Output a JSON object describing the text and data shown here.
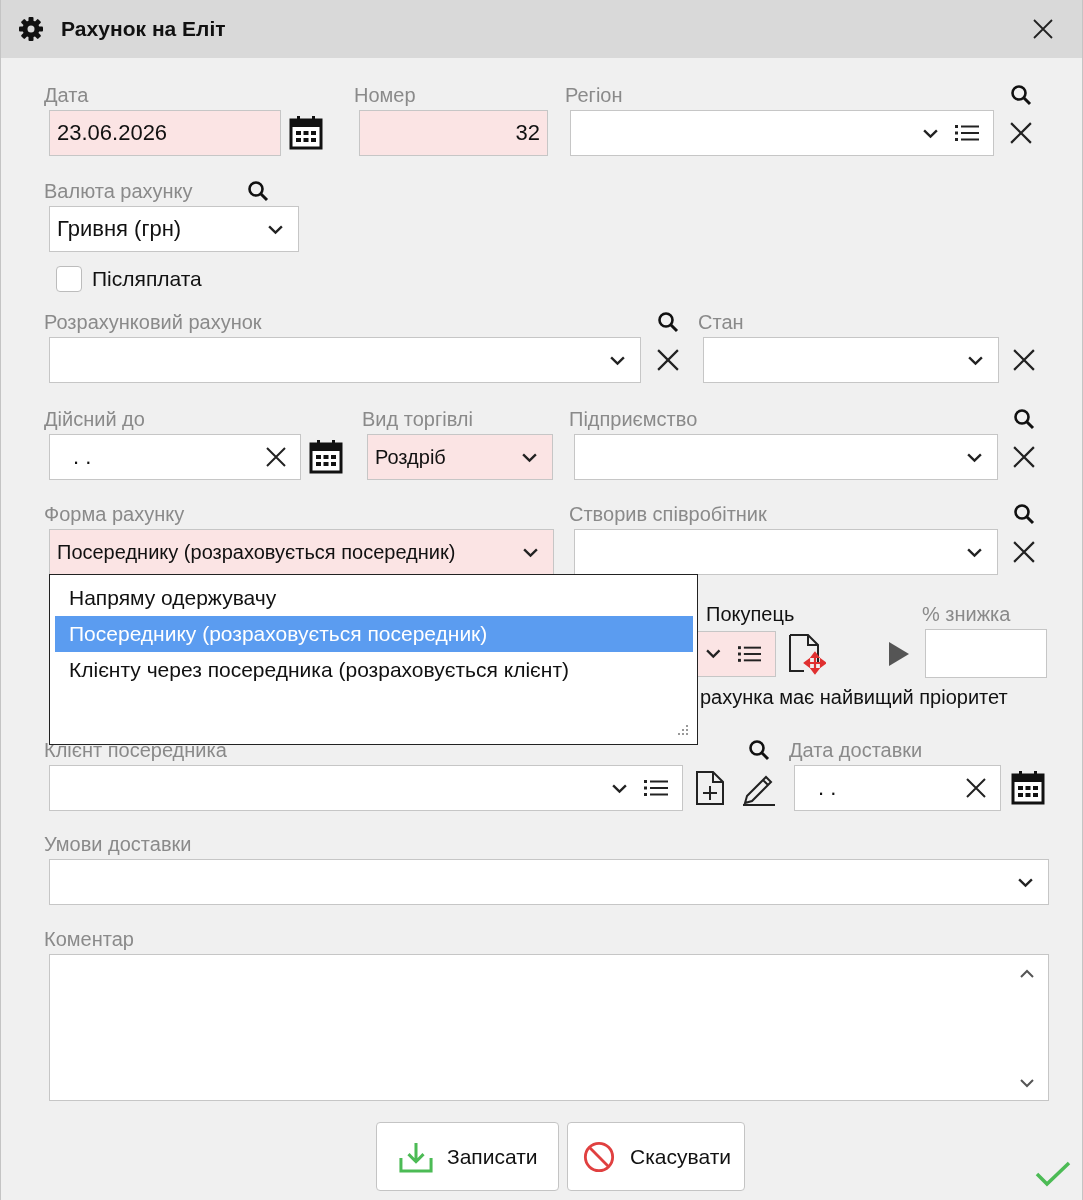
{
  "window": {
    "title": "Рахунок на Еліт"
  },
  "date": {
    "label": "Дата",
    "value": "23.06.2026",
    "required": true
  },
  "number": {
    "label": "Номер",
    "value": "32",
    "required": true
  },
  "region": {
    "label": "Регіон"
  },
  "currency": {
    "label": "Валюта рахунку",
    "value": "Гривня (грн)"
  },
  "postpayment": {
    "label": "Післяплата",
    "checked": false
  },
  "settlement_account": {
    "label": "Розрахунковий рахунок"
  },
  "state": {
    "label": "Стан"
  },
  "valid_until": {
    "label": "Дійсний до",
    "value": ". ."
  },
  "trade_type": {
    "label": "Вид торгівлі",
    "value": "Роздріб",
    "required": true
  },
  "enterprise": {
    "label": "Підприємство"
  },
  "invoice_form": {
    "label": "Форма рахунку",
    "value": "Посереднику (розраховується посередник)",
    "required": true,
    "expanded": true,
    "options": [
      {
        "label": "Напряму одержувачу",
        "selected": false
      },
      {
        "label": "Посереднику (розраховується посередник)",
        "selected": true
      },
      {
        "label": "Клієнту через посередника (розраховується клієнт)",
        "selected": false
      }
    ]
  },
  "created_by": {
    "label": "Створив співробітник"
  },
  "buyer": {
    "label": "Покупець",
    "required": true
  },
  "discount": {
    "label": "% знижка"
  },
  "priority_note": "рахунка має найвищий пріоритет",
  "intermediary_client": {
    "label": "Клієнт посередника"
  },
  "delivery_date": {
    "label": "Дата доставки",
    "value": ". ."
  },
  "delivery_terms": {
    "label": "Умови доставки"
  },
  "comment": {
    "label": "Коментар"
  },
  "buttons": [
    {
      "label": "Записати",
      "kind": "save"
    },
    {
      "label": "Скасувати",
      "kind": "cancel"
    }
  ]
}
